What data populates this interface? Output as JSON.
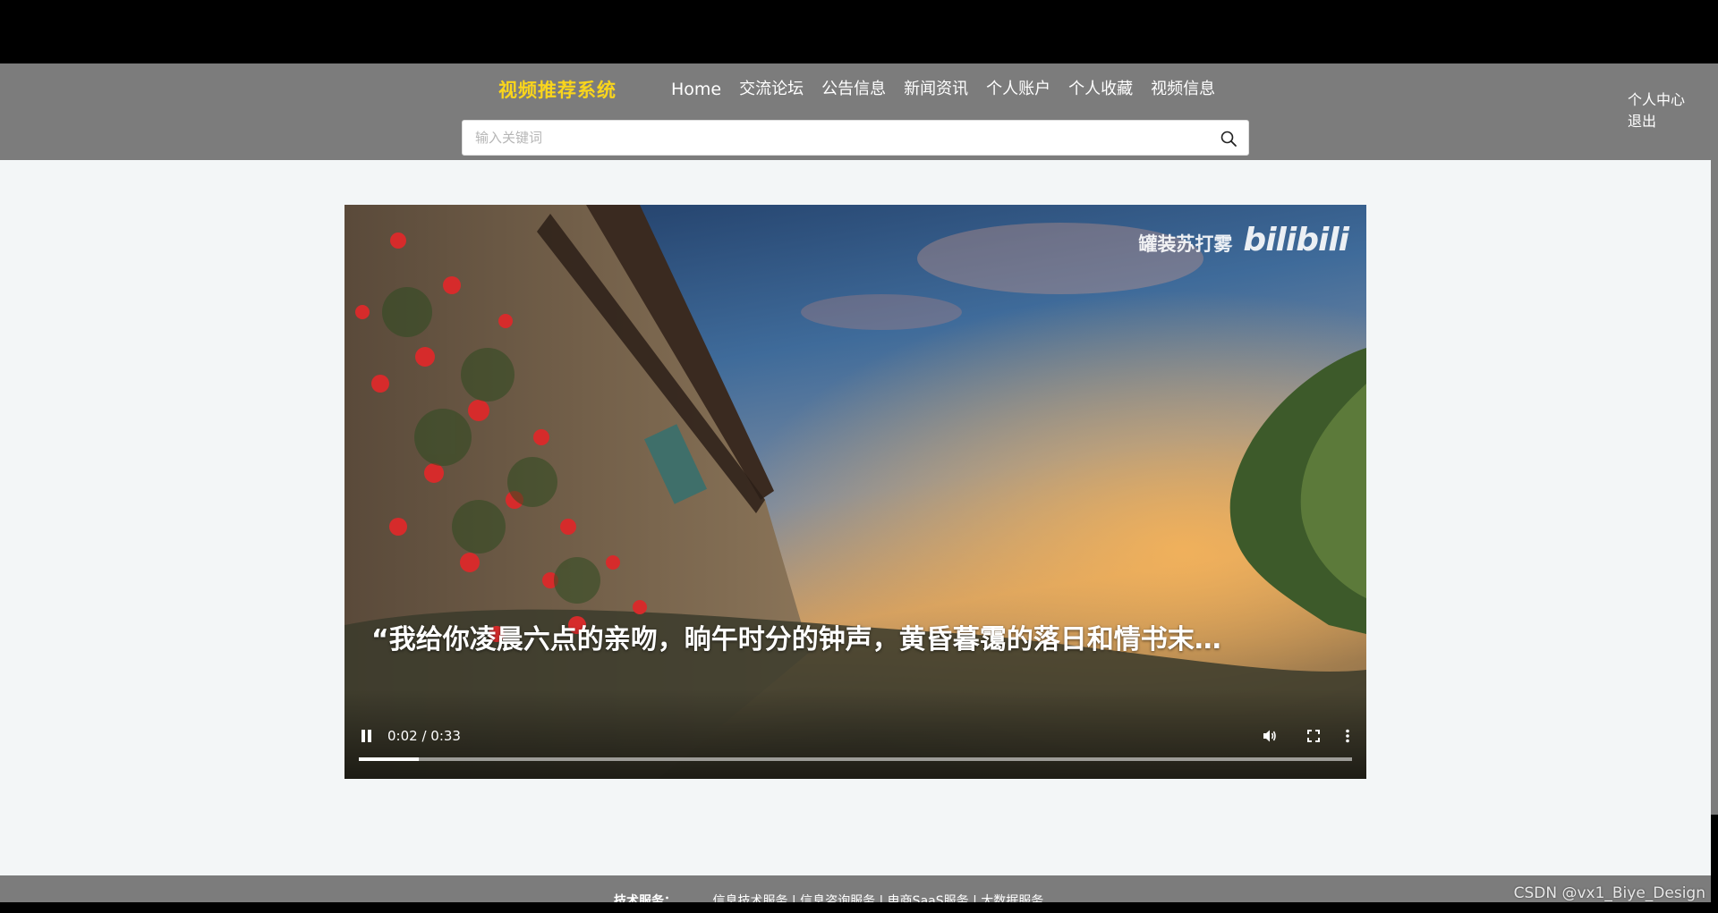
{
  "header": {
    "brand": "视频推荐系统",
    "nav": [
      "Home",
      "交流论坛",
      "公告信息",
      "新闻资讯",
      "个人账户",
      "个人收藏",
      "视频信息"
    ],
    "search_placeholder": "输入关键词",
    "search_icon": "search-icon",
    "user_center": "个人中心",
    "logout": "退出",
    "brand_color": "#f9d51c"
  },
  "video": {
    "watermark_uploader": "罐装苏打雾",
    "watermark_logo": "bilibili",
    "subtitle": "“我给你凌晨六点的亲吻，晌午时分的钟声，黄昏暮霭的落日和情书末…",
    "state": "playing",
    "time": "0:02 / 0:33",
    "progress_fraction": 0.0606,
    "icons": [
      "pause-icon",
      "volume-icon",
      "fullscreen-icon",
      "more-options-icon"
    ]
  },
  "footer": {
    "label": "技术服务：",
    "links": "信息技术服务 | 信息咨询服务 | 电商SaaS服务 | 大数据服务"
  },
  "overlay": {
    "csdn_watermark": "CSDN @vx1_Biye_Design"
  }
}
